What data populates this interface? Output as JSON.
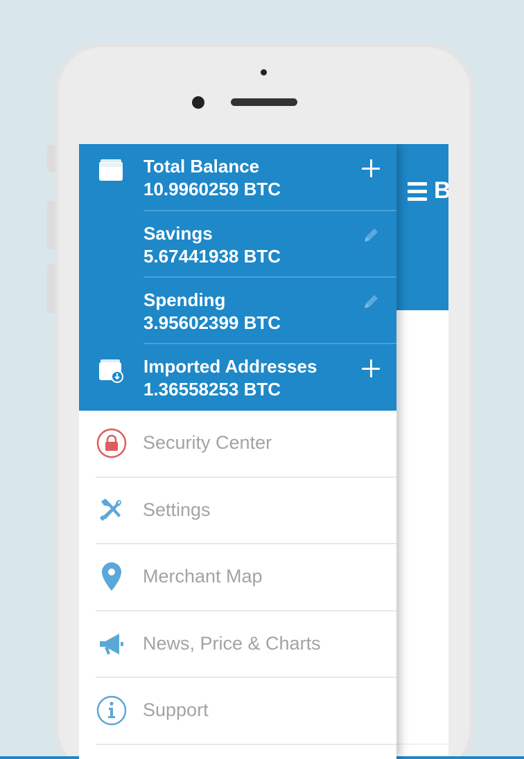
{
  "colors": {
    "background": "#d9e6ec",
    "primary": "#1e88c8",
    "security_red": "#e05b5b",
    "menu_icon_blue": "#5aa8d8",
    "menu_text_gray": "#a3a3a3"
  },
  "header": {
    "title_fragment": "B"
  },
  "accounts": [
    {
      "name": "Total Balance",
      "balance": "10.9960259 BTC",
      "icon": "wallet-icon",
      "action": "add-icon"
    },
    {
      "name": "Savings",
      "balance": "5.67441938 BTC",
      "icon": "",
      "action": "edit-icon"
    },
    {
      "name": "Spending",
      "balance": "3.95602399 BTC",
      "icon": "",
      "action": "edit-icon"
    },
    {
      "name": "Imported Addresses",
      "balance": "1.36558253 BTC",
      "icon": "imported-wallet-icon",
      "action": "add-icon"
    }
  ],
  "menu": [
    {
      "label": "Security Center",
      "icon": "lock-icon"
    },
    {
      "label": "Settings",
      "icon": "tools-icon"
    },
    {
      "label": "Merchant Map",
      "icon": "map-pin-icon"
    },
    {
      "label": "News, Price & Charts",
      "icon": "megaphone-icon"
    },
    {
      "label": "Support",
      "icon": "info-icon"
    }
  ]
}
